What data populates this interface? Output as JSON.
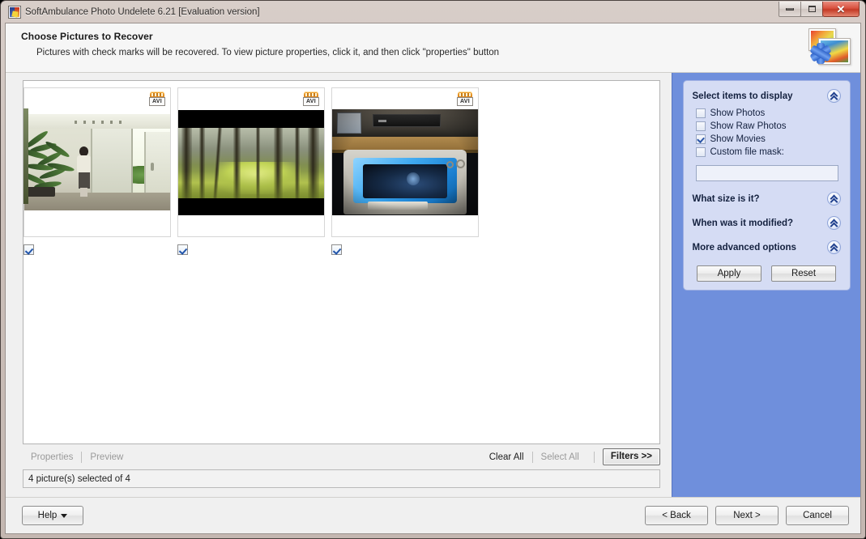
{
  "window": {
    "title": "SoftAmbulance Photo Undelete 6.21 [Evaluation version]",
    "app_icon": "photo-undelete-icon",
    "minimize_label": "–",
    "maximize_label": "□",
    "close_label": "✕"
  },
  "banner": {
    "title": "Choose Pictures to Recover",
    "subtitle": "Pictures with check marks will be recovered. To view picture properties, click it, and then click \"properties\" button",
    "logo_icon": "photo-recovery-logo"
  },
  "thumbnails": [
    {
      "badge": "AVI",
      "badge_icon": "avi-film-icon",
      "checked": true,
      "alt": "interior hallway with bamboo plant and person"
    },
    {
      "badge": "AVI",
      "badge_icon": "avi-film-icon",
      "checked": true,
      "alt": "sunlit forest path letterboxed frame"
    },
    {
      "badge": "AVI",
      "badge_icon": "avi-film-icon",
      "checked": true,
      "alt": "CRT monitor on wooden desk with blue glowing screen"
    }
  ],
  "actionbar": {
    "properties_label": "Properties",
    "preview_label": "Preview",
    "clear_all_label": "Clear All",
    "select_all_label": "Select All",
    "filters_label": "Filters >>"
  },
  "status": {
    "text": "4 picture(s) selected of 4"
  },
  "sidebar": {
    "accent_color": "#6f8fdc",
    "panel_color": "#d5dcf4",
    "sections": [
      {
        "title": "Select items to display",
        "collapse_icon": "chevron-double-up-icon"
      },
      {
        "title": "What size is it?",
        "collapse_icon": "chevron-double-up-icon"
      },
      {
        "title": "When was it modified?",
        "collapse_icon": "chevron-double-up-icon"
      },
      {
        "title": "More advanced options",
        "collapse_icon": "chevron-double-up-icon"
      }
    ],
    "options": [
      {
        "label": "Show Photos",
        "checked": false
      },
      {
        "label": "Show Raw Photos",
        "checked": false
      },
      {
        "label": "Show Movies",
        "checked": true
      },
      {
        "label": "Custom file mask:",
        "checked": false
      }
    ],
    "mask_value": "",
    "mask_placeholder": "",
    "apply_label": "Apply",
    "reset_label": "Reset"
  },
  "footer": {
    "help_label": "Help",
    "back_label": "< Back",
    "next_label": "Next >",
    "cancel_label": "Cancel"
  }
}
